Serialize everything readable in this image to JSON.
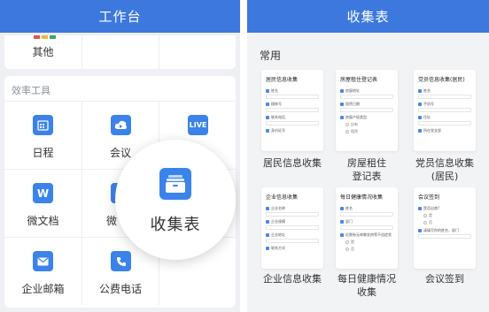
{
  "left_screen": {
    "title": "工作台",
    "top_row": {
      "items": [
        {
          "label": "其他",
          "icon": "grid-colored-icon"
        }
      ]
    },
    "section_title": "效率工具",
    "tools": [
      {
        "label": "日程",
        "icon": "calendar-icon",
        "color": "#3b83e8"
      },
      {
        "label": "会议",
        "icon": "cloud-video-icon",
        "color": "#3b83e8"
      },
      {
        "label": "",
        "icon": "live-icon",
        "icon_text": "LIVE",
        "color": "#3b83e8"
      },
      {
        "label": "微文档",
        "icon": "w-document-icon",
        "icon_text": "W",
        "color": "#3b83e8"
      },
      {
        "label": "微",
        "icon": "collect-form-icon",
        "color": "#3b83e8"
      },
      {
        "label": "",
        "icon": "",
        "color": "#3b83e8"
      },
      {
        "label": "企业邮箱",
        "icon": "mail-icon",
        "color": "#3b83e8"
      },
      {
        "label": "公费电话",
        "icon": "phone-icon",
        "color": "#3b83e8"
      }
    ],
    "magnifier": {
      "label": "收集表",
      "icon": "collect-form-icon"
    }
  },
  "right_screen": {
    "title": "收集表",
    "section_title": "常用",
    "templates": [
      {
        "name": "居民信息收集",
        "preview_title": "居民信息收集",
        "fields": [
          "姓名",
          "楼栋号",
          "联系电话",
          "身份证号"
        ]
      },
      {
        "name": "房屋租住\n登记表",
        "preview_title": "房屋租住登记表",
        "fields": [
          "房屋地址",
          "租赁日期",
          "房屋产权类型"
        ],
        "options": [
          "自有",
          "租赁"
        ]
      },
      {
        "name": "党员信息收集\n(居民)",
        "preview_title": "党员信息收集(居民)",
        "fields": [
          "姓名",
          "手机号",
          "住址",
          "所在党支部"
        ]
      },
      {
        "name": "企业信息收集",
        "preview_title": "企业信息收集",
        "fields": [
          "企业名称",
          "企业规模",
          "企业地址",
          "联系方式"
        ]
      },
      {
        "name": "每日健康情况\n收集",
        "preview_title": "每日健康情况收集",
        "fields": [
          "姓名",
          "部门",
          "近期有无咳嗽发热等不适症状"
        ],
        "options": [
          "是",
          "否"
        ]
      },
      {
        "name": "会议签到",
        "preview_title": "会议签到",
        "fields": [
          "是否出席?",
          "请填写你的姓名、部门"
        ],
        "options": [
          "是",
          "否"
        ]
      }
    ]
  },
  "colors": {
    "accent": "#3d78de",
    "icon_blue": "#3b83e8"
  }
}
